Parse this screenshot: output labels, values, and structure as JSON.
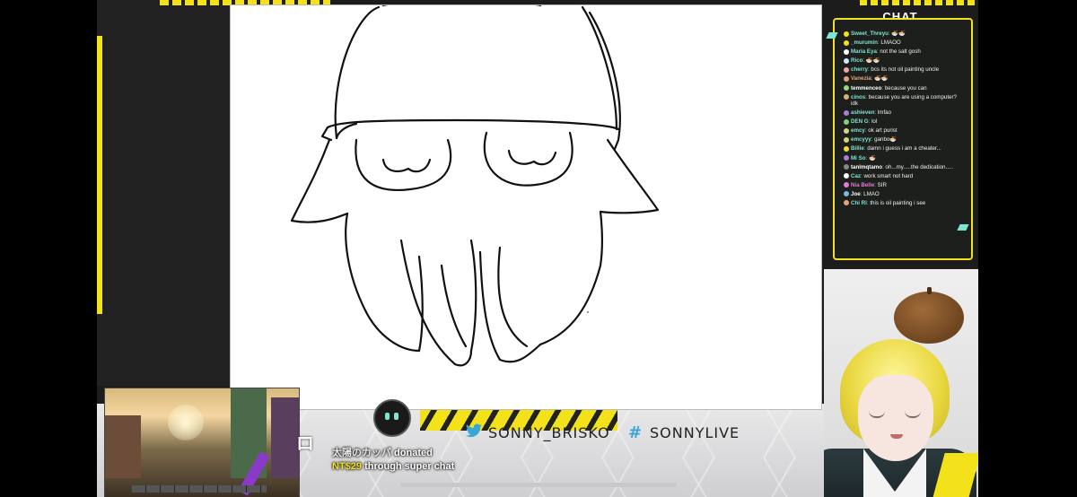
{
  "chat": {
    "header": "CHAT",
    "messages": [
      {
        "user": "Sweet_Threyu",
        "text": "🍜🍜",
        "color": "#7be6d4",
        "avatar": "#f3e21a"
      },
      {
        "user": "_murumin",
        "text": "LMAOO",
        "color": "#7be6d4",
        "avatar": "#f3e21a"
      },
      {
        "user": "Maria Eya",
        "text": "not the salt gosh",
        "color": "#7be6d4",
        "avatar": "#ffffff"
      },
      {
        "user": "Rico",
        "text": "🍜🍜",
        "color": "#7be6d4",
        "avatar": "#cfe8ff"
      },
      {
        "user": "cherry",
        "text": "bcs its not oil painting uncle",
        "color": "#7be6d4",
        "avatar": "#f2a7a7"
      },
      {
        "user": "Vanezia",
        "text": "🍜🍜",
        "color": "#e6a37b",
        "avatar": "#e6a37b"
      },
      {
        "user": "temmenceo",
        "text": "because you can",
        "color": "#ffffff",
        "avatar": "#9bd67b"
      },
      {
        "user": "cinos",
        "text": "because you are using a computer? idk",
        "color": "#7be6d4",
        "avatar": "#d6b37b"
      },
      {
        "user": "ashieven",
        "text": "lmfao",
        "color": "#7be6d4",
        "avatar": "#b07bd6"
      },
      {
        "user": "DEN G",
        "text": "lol",
        "color": "#7be6d4",
        "avatar": "#7bd67e"
      },
      {
        "user": "emcy",
        "text": "ok art purist",
        "color": "#7be6d4",
        "avatar": "#d6d67b"
      },
      {
        "user": "emcyyy",
        "text": "ganbo🍜",
        "color": "#7be6d4",
        "avatar": "#d6d67b"
      },
      {
        "user": "Billie",
        "text": "damn i guess i am a cheater...",
        "color": "#7be6d4",
        "avatar": "#f3e21a"
      },
      {
        "user": "Mi So",
        "text": "🍜",
        "color": "#7be6d4",
        "avatar": "#b07bd6"
      },
      {
        "user": "tanlmqtamo",
        "text": "oh...my.....the dedication.....",
        "color": "#ffffff",
        "avatar": "#888888"
      },
      {
        "user": "Caz",
        "text": "work smart not hard",
        "color": "#7be6d4",
        "avatar": "#ffffff"
      },
      {
        "user": "Nia Belle",
        "text": "SIR",
        "color": "#e27bd6",
        "avatar": "#e27bd6"
      },
      {
        "user": "Joe",
        "text": "LMAO",
        "color": "#ffffff",
        "avatar": "#7bb8e6"
      },
      {
        "user": "Chi Ri",
        "text": "this is oil painting i see",
        "color": "#7be6d4",
        "avatar": "#e6a37b"
      }
    ]
  },
  "socials": {
    "twitter": "SONNY_BRISKO",
    "hashtag": "SONNYLIVE"
  },
  "donation": {
    "name": "太陽のカッパ",
    "verb": " donated",
    "amount": "NT$29",
    "suffix": " through super chat"
  },
  "icons": {
    "twitter": "twitter-bird-icon",
    "hashtag": "hashtag-icon"
  }
}
